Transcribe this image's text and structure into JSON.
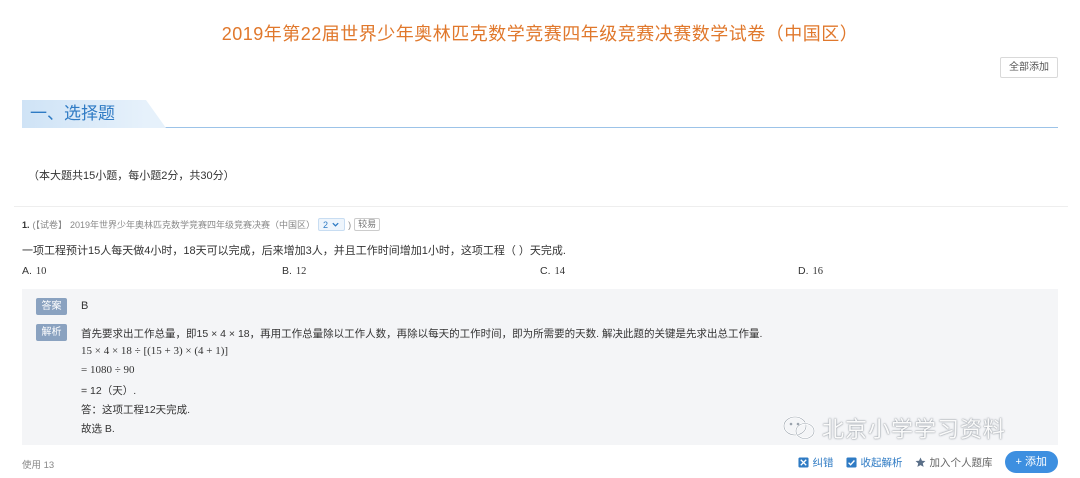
{
  "page": {
    "title": "2019年第22届世界少年奥林匹克数学竞赛四年级竞赛决赛数学试卷（中国区）"
  },
  "toolbar": {
    "add_all_label": "全部添加"
  },
  "section": {
    "heading": "一、选择题",
    "description": "（本大题共15小题，每小题2分，共30分）"
  },
  "question": {
    "number": "1.",
    "source_prefix": "(【试卷】",
    "source_title": "2019年世界少年奥林匹克数学竞赛四年级竞赛决赛（中国区）",
    "score": "2",
    "paren_close": ")",
    "difficulty": "较易",
    "text": "一项工程预计15人每天做4小时，18天可以完成，后来增加3人，并且工作时间增加1小时，这项工程（   ）天完成.",
    "options": [
      {
        "letter": "A.",
        "value": "10"
      },
      {
        "letter": "B.",
        "value": "12"
      },
      {
        "letter": "C.",
        "value": "14"
      },
      {
        "letter": "D.",
        "value": "16"
      }
    ]
  },
  "answer": {
    "answer_tag": "答案",
    "answer_value": "B",
    "analysis_tag": "解析",
    "lines": [
      "首先要求出工作总量，即15 × 4 × 18，再用工作总量除以工作人数，再除以每天的工作时间，即为所需要的天数. 解决此题的关键是先求出总工作量.",
      "15 × 4 × 18 ÷ [(15 + 3) × (4 + 1)]",
      "= 1080 ÷ 90",
      "= 12（天）.",
      "答：这项工程12天完成.",
      "故选 B."
    ]
  },
  "watermark": {
    "text": "北京小学学习资料"
  },
  "footer": {
    "usage": "使用 13",
    "report_label": "纠错",
    "collapse_label": "收起解析",
    "add_personal_label": "加入个人题库",
    "add_label": "+ 添加"
  },
  "colors": {
    "accent": "#2f7bc4",
    "title": "#e0782c",
    "button": "#3d8fe0"
  },
  "icons": [
    "chevron-down-icon",
    "report-icon",
    "check-box-icon",
    "star-icon",
    "wechat-icon"
  ]
}
